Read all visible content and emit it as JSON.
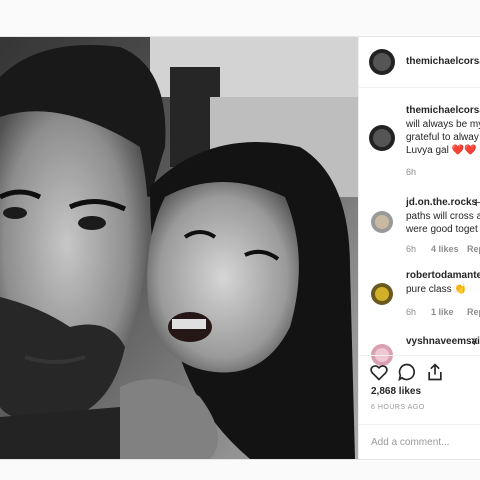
{
  "post": {
    "author": "themichaelcorsale",
    "caption": {
      "username": "themichaelcorsale",
      "lines": [
        "will always be my",
        "grateful to alway",
        "Luvya gal ❤️❤️"
      ],
      "time": "6h"
    },
    "comments": [
      {
        "username": "jd.on.the.rocks",
        "lines": [
          "H",
          "paths will cross a",
          "were good toget"
        ],
        "time": "6h",
        "likes": "4 likes",
        "reply": "Rep"
      },
      {
        "username": "robertodamante",
        "lines": [
          "pure class 👏"
        ],
        "time": "6h",
        "likes": "1 like",
        "reply": "Rep"
      },
      {
        "username": "vyshnaveemsai",
        "lines": [
          "Y"
        ]
      }
    ],
    "likes_count": "2,868 likes",
    "posted_ago": "6 HOURS AGO",
    "add_comment_placeholder": "Add a comment..."
  },
  "icons": [
    "heart-icon",
    "comment-icon",
    "share-icon"
  ]
}
